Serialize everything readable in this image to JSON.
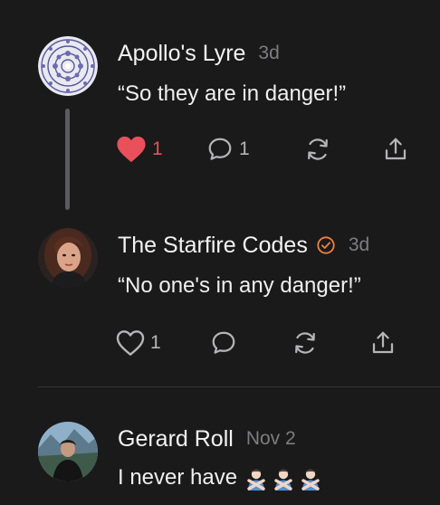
{
  "posts": [
    {
      "author": "Apollo's Lyre",
      "time": "3d",
      "text": "“So they are in danger!”",
      "verified": false,
      "likes": "1",
      "liked": true,
      "replies": "1"
    },
    {
      "author": "The Starfire Codes",
      "time": "3d",
      "text": "“No one's in any danger!”",
      "verified": true,
      "likes": "1",
      "liked": false,
      "replies": ""
    },
    {
      "author": "Gerard Roll",
      "time": "Nov 2",
      "text": "I never have",
      "emoji": [
        "person-gesturing-no",
        "person-gesturing-no",
        "person-gesturing-no"
      ]
    }
  ],
  "colors": {
    "background": "#1a1a1b",
    "like_active": "#e8505b",
    "verified_badge": "#f0803c",
    "secondary_text": "#7d7d80"
  },
  "icons": [
    "heart-icon",
    "comment-icon",
    "repost-icon",
    "share-icon",
    "verified-badge-icon"
  ]
}
